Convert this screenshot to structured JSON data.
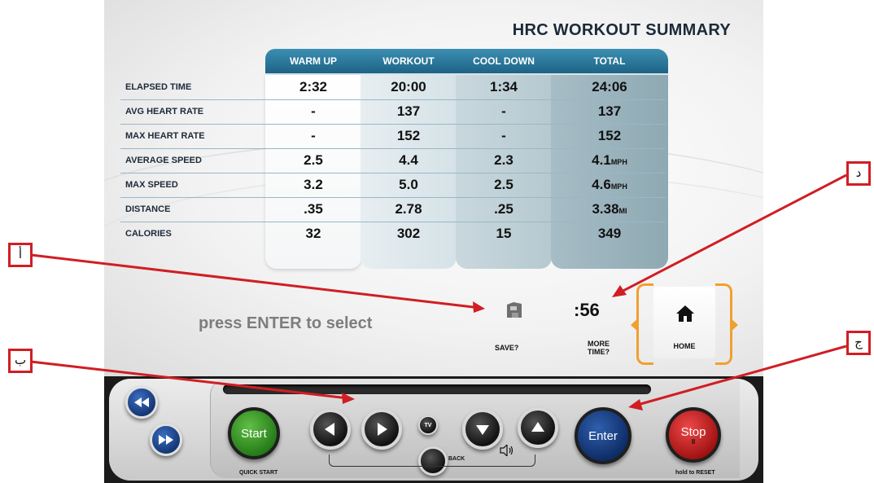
{
  "screen": {
    "title": "HRC WORKOUT SUMMARY",
    "columns": [
      "WARM UP",
      "WORKOUT",
      "COOL DOWN",
      "TOTAL"
    ],
    "rows": [
      {
        "label": "ELAPSED TIME",
        "values": [
          "2:32",
          "20:00",
          "1:34",
          "24:06"
        ],
        "unit": ""
      },
      {
        "label": "AVG HEART RATE",
        "values": [
          "-",
          "137",
          "-",
          "137"
        ],
        "unit": ""
      },
      {
        "label": "MAX HEART RATE",
        "values": [
          "-",
          "152",
          "-",
          "152"
        ],
        "unit": ""
      },
      {
        "label": "AVERAGE SPEED",
        "values": [
          "2.5",
          "4.4",
          "2.3",
          "4.1"
        ],
        "unit": "MPH"
      },
      {
        "label": "MAX SPEED",
        "values": [
          "3.2",
          "5.0",
          "2.5",
          "4.6"
        ],
        "unit": "MPH"
      },
      {
        "label": "DISTANCE",
        "values": [
          ".35",
          "2.78",
          ".25",
          "3.38"
        ],
        "unit": "MI"
      },
      {
        "label": "CALORIES",
        "values": [
          "32",
          "302",
          "15",
          "349"
        ],
        "unit": ""
      }
    ],
    "prompt": "press ENTER to select",
    "save_label": "SAVE?",
    "timer": ":56",
    "more_time_line1": "MORE",
    "more_time_line2": "TIME?",
    "home_label": "HOME",
    "accent_color": "#f0a030",
    "header_color": "#1d6386"
  },
  "console": {
    "start_label": "Start",
    "quick_start_label": "QUICK START",
    "enter_label": "Enter",
    "stop_label": "Stop",
    "stop_sub": "II",
    "reset_label": "hold to RESET",
    "back_label": "BACK",
    "tv_label": "TV"
  },
  "callouts": {
    "a": "أ",
    "b": "ب",
    "c": "ج",
    "d": "د"
  }
}
